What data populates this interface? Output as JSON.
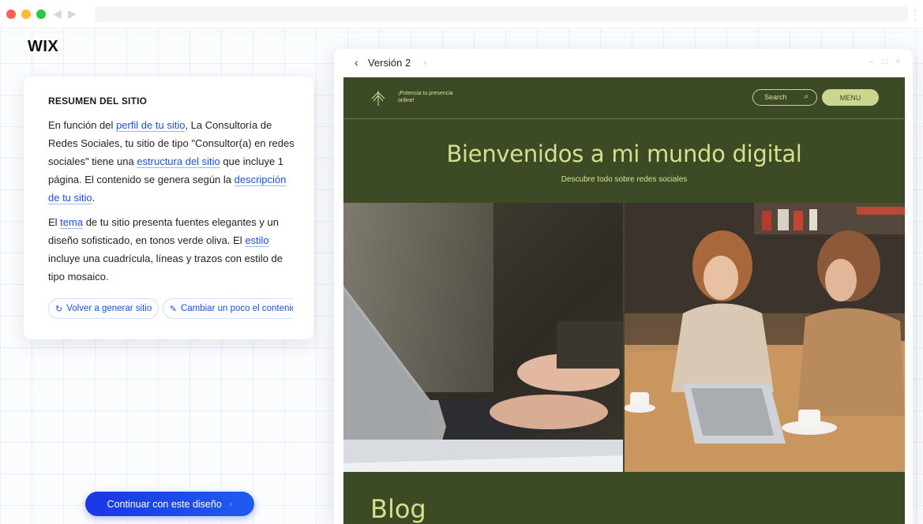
{
  "browser": {
    "traffic_lights": [
      "close",
      "minimize",
      "maximize"
    ],
    "colors": {
      "close": "#ff5f57",
      "minimize": "#febc2e",
      "maximize": "#28c840"
    }
  },
  "editor": {
    "logo": "WIX",
    "summary": {
      "title": "RESUMEN DEL SITIO",
      "p1": {
        "t1": "En función del ",
        "link1": "perfil de tu sitio",
        "t2": ", La Consultoría de Redes Sociales, tu sitio de tipo \"Consultor(a) en redes sociales\" tiene una ",
        "link2": "estructura del sitio",
        "t3": " que incluye 1 página. El contenido se genera según la ",
        "link3": "descripción de tu sitio",
        "t4": "."
      },
      "p2": {
        "t1": "El ",
        "link1": "tema",
        "t2": " de tu sitio presenta fuentes elegantes y un diseño sofisticado, en tonos verde oliva. El ",
        "link2": "estilo",
        "t3": " incluye una cuadrícula, líneas y trazos con estilo de tipo mosaico."
      },
      "actions": {
        "regenerate": "Volver a generar sitio",
        "regenerate_icon": "refresh-icon",
        "tweak": "Cambiar un poco el contenido",
        "tweak_icon": "magic-wand-icon"
      }
    },
    "cta": "Continuar con este diseño",
    "accent_color": "#1d4ed8"
  },
  "preview": {
    "version_label": "Versión 2",
    "site": {
      "tagline": "¡Potencia tu presencia online!",
      "search_placeholder": "Search",
      "menu_label": "MENU",
      "hero_title": "Bienvenidos a mi mundo digital",
      "hero_subtitle": "Descubre todo sobre redes sociales",
      "blog_title": "Blog",
      "colors": {
        "background": "#3c4a26",
        "accent": "#d4e08c"
      }
    }
  }
}
